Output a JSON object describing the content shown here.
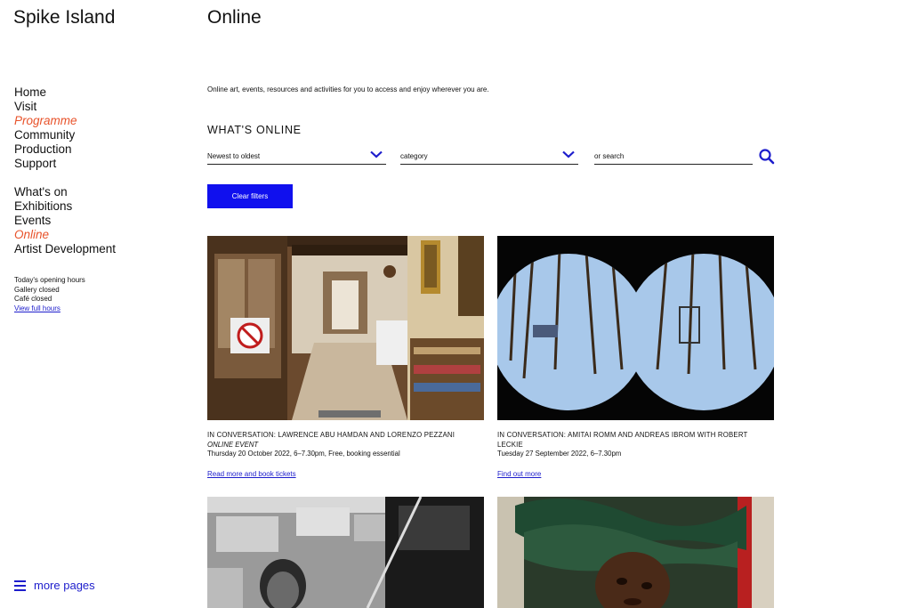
{
  "site": {
    "title": "Spike Island"
  },
  "page": {
    "title": "Online",
    "intro": "Online art, events, resources and activities for you to access and enjoy wherever you are.",
    "section_heading": "WHAT'S ONLINE"
  },
  "nav_primary": [
    {
      "label": "Home"
    },
    {
      "label": "Visit"
    },
    {
      "label": "Programme",
      "active": true
    },
    {
      "label": "Community"
    },
    {
      "label": "Production"
    },
    {
      "label": "Support"
    }
  ],
  "nav_secondary": [
    {
      "label": "What's on"
    },
    {
      "label": "Exhibitions"
    },
    {
      "label": "Events"
    },
    {
      "label": "Online",
      "active": true
    },
    {
      "label": "Artist Development"
    }
  ],
  "hours": {
    "heading": "Today's opening hours",
    "gallery": "Gallery closed",
    "cafe": "Café closed",
    "link": "View full hours"
  },
  "more_pages": {
    "label": "more pages",
    "icon": "hamburger-menu-icon"
  },
  "filters": {
    "sort": "Newest to oldest",
    "category": "category",
    "search_placeholder": "or search",
    "clear_label": "Clear filters"
  },
  "colors": {
    "accent": "#1010ee",
    "link": "#1d1dcc",
    "active_nav": "#e8532b"
  },
  "cards": [
    {
      "title": "IN CONVERSATION: LAWRENCE ABU HAMDAN AND LORENZO PEZZANI",
      "subtitle": "ONLINE EVENT",
      "date": "Thursday 20 October 2022, 6–7.30pm, Free, booking essential",
      "link": "Read more and book tickets"
    },
    {
      "title": "IN CONVERSATION: AMITAI ROMM AND ANDREAS IBROM WITH ROBERT LECKIE",
      "subtitle": "",
      "date": "Tuesday 27 September 2022, 6–7.30pm",
      "link": "Find out more"
    }
  ]
}
